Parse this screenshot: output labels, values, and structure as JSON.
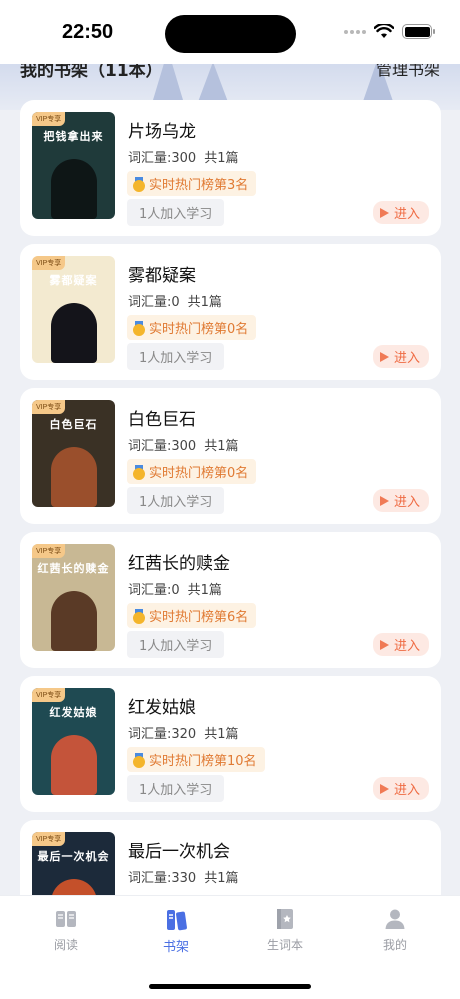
{
  "status_bar": {
    "time": "22:50"
  },
  "header": {
    "title": "我的书架（11本）",
    "manage": "管理书架"
  },
  "books": [
    {
      "title": "片场乌龙",
      "cover_title": "把钱拿出来",
      "vip": "VIP专享",
      "words": "词汇量:300",
      "parts": "共1篇",
      "rank": "实时热门榜第3名",
      "learners": "1人加入学习",
      "enter": "进入",
      "cover_color": "#1f3a3a",
      "figure_color": "#0e1616"
    },
    {
      "title": "雾都疑案",
      "cover_title": "雾都疑案",
      "vip": "VIP专享",
      "words": "词汇量:0",
      "parts": "共1篇",
      "rank": "实时热门榜第0名",
      "learners": "1人加入学习",
      "enter": "进入",
      "cover_color": "#f3ead0",
      "figure_color": "#14141a"
    },
    {
      "title": "白色巨石",
      "cover_title": "白色巨石",
      "vip": "VIP专享",
      "words": "词汇量:300",
      "parts": "共1篇",
      "rank": "实时热门榜第0名",
      "learners": "1人加入学习",
      "enter": "进入",
      "cover_color": "#3a3125",
      "figure_color": "#9a4f2c"
    },
    {
      "title": "红茜长的赎金",
      "cover_title": "红茜长的赎金",
      "vip": "VIP专享",
      "words": "词汇量:0",
      "parts": "共1篇",
      "rank": "实时热门榜第6名",
      "learners": "1人加入学习",
      "enter": "进入",
      "cover_color": "#c8b894",
      "figure_color": "#5a3a26"
    },
    {
      "title": "红发姑娘",
      "cover_title": "红发姑娘",
      "vip": "VIP专享",
      "words": "词汇量:320",
      "parts": "共1篇",
      "rank": "实时热门榜第10名",
      "learners": "1人加入学习",
      "enter": "进入",
      "cover_color": "#1f4a52",
      "figure_color": "#c4543a"
    },
    {
      "title": "最后一次机会",
      "cover_title": "最后一次机会",
      "vip": "VIP专享",
      "words": "词汇量:330",
      "parts": "共1篇",
      "rank": "",
      "learners": "",
      "enter": "",
      "cover_color": "#1c2a3a",
      "figure_color": "#c4502a"
    }
  ],
  "tabs": [
    {
      "label": "阅读",
      "icon": "book-open-icon",
      "active": false
    },
    {
      "label": "书架",
      "icon": "bookshelf-icon",
      "active": true
    },
    {
      "label": "生词本",
      "icon": "notebook-icon",
      "active": false
    },
    {
      "label": "我的",
      "icon": "user-icon",
      "active": false
    }
  ],
  "colors": {
    "accent": "#4a6fe3",
    "enter": "#ef6b43",
    "rank": "#e07a33"
  }
}
